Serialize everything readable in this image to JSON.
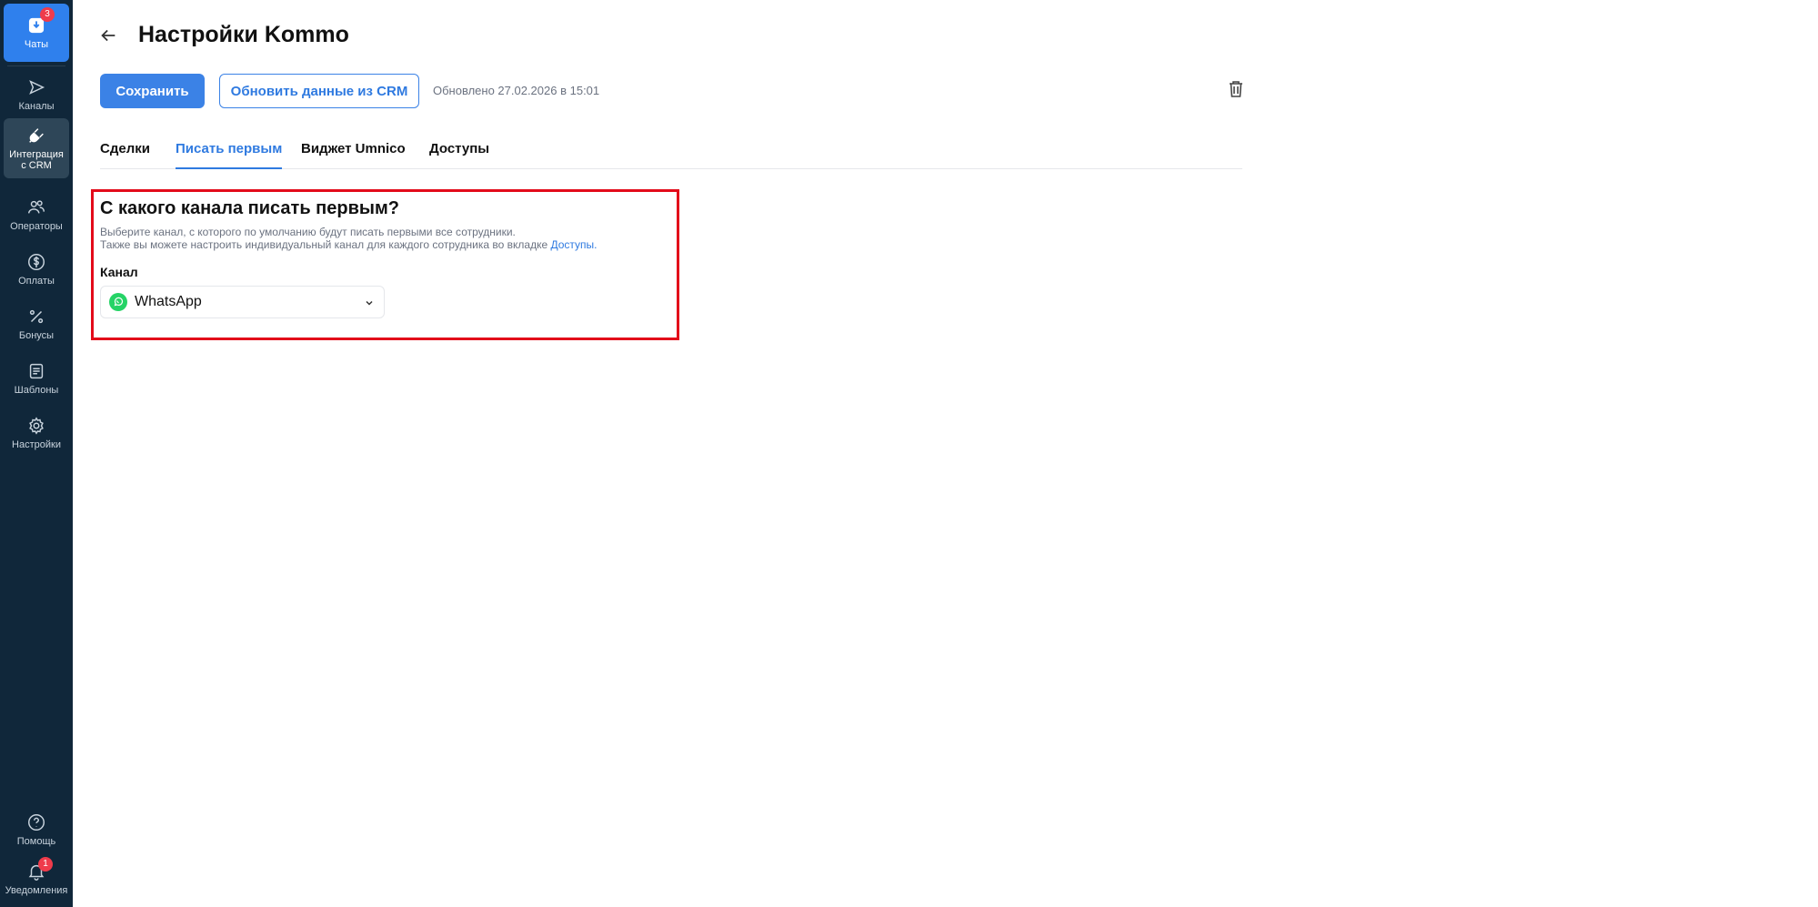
{
  "sidebar": {
    "items": [
      {
        "label": "Чаты",
        "badge": "3"
      },
      {
        "label": "Каналы"
      },
      {
        "label": "Интеграция\nс CRM"
      },
      {
        "label": "Операторы"
      },
      {
        "label": "Оплаты"
      },
      {
        "label": "Бонусы"
      },
      {
        "label": "Шаблоны"
      },
      {
        "label": "Настройки"
      }
    ],
    "bottom": [
      {
        "label": "Помощь"
      },
      {
        "label": "Уведомления",
        "badge": "1"
      }
    ]
  },
  "header": {
    "title": "Настройки Kommo",
    "save_label": "Сохранить",
    "refresh_label": "Обновить данные из CRM",
    "updated_text": "Обновлено 27.02.2026 в 15:01"
  },
  "tabs": [
    {
      "label": "Сделки",
      "active": false
    },
    {
      "label": "Писать первым",
      "active": true
    },
    {
      "label": "Виджет Umnico",
      "active": false
    },
    {
      "label": "Доступы",
      "active": false
    }
  ],
  "section": {
    "title": "С какого канала писать первым?",
    "desc_line1": "Выберите канал, с которого по умолчанию будут писать первыми все сотрудники.",
    "desc_line2": "Также вы можете настроить индивидуальный канал для каждого сотрудника во вкладке",
    "desc_link": "Доступы.",
    "field_label": "Канал",
    "selected_channel": "WhatsApp"
  },
  "colors": {
    "sidebar_bg": "#10273a",
    "accent": "#3b82e6",
    "highlight": "#e30b1a",
    "whatsapp": "#25d366"
  }
}
